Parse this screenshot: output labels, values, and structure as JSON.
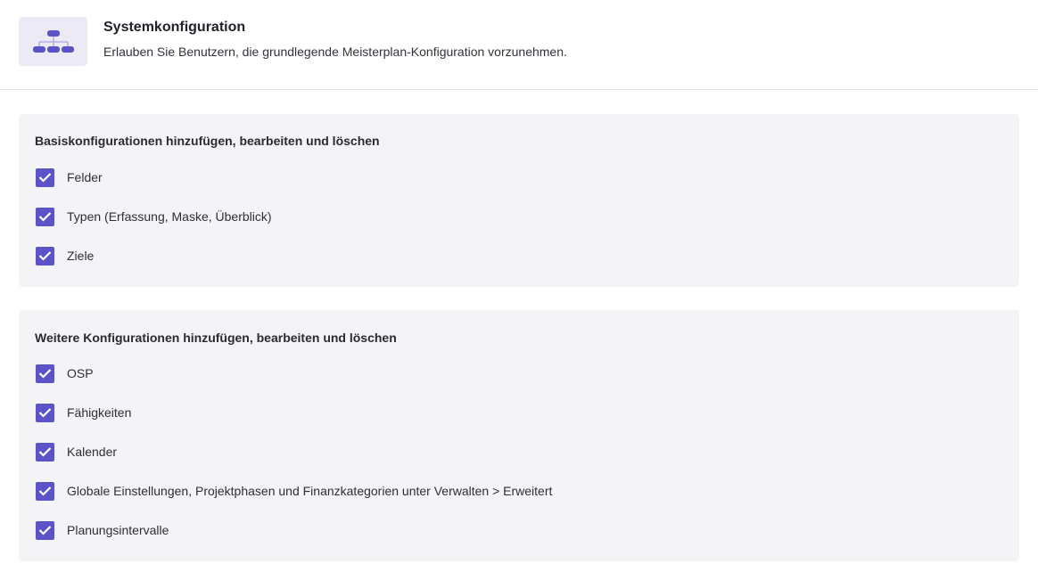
{
  "header": {
    "icon": "hierarchy-icon",
    "title": "Systemkonfiguration",
    "description": "Erlauben Sie Benutzern, die grundlegende Meisterplan-Konfiguration vorzunehmen."
  },
  "colors": {
    "accent": "#5b53c8",
    "section_background": "#f4f4f7",
    "icon_background": "#ecebf5"
  },
  "sections": [
    {
      "title": "Basiskonfigurationen hinzufügen, bearbeiten und löschen",
      "options": [
        {
          "label": "Felder",
          "checked": true
        },
        {
          "label": "Typen (Erfassung, Maske, Überblick)",
          "checked": true
        },
        {
          "label": "Ziele",
          "checked": true
        }
      ]
    },
    {
      "title": "Weitere Konfigurationen hinzufügen, bearbeiten und löschen",
      "options": [
        {
          "label": "OSP",
          "checked": true
        },
        {
          "label": "Fähigkeiten",
          "checked": true
        },
        {
          "label": "Kalender",
          "checked": true
        },
        {
          "label": "Globale Einstellungen, Projektphasen und Finanzkategorien unter Verwalten > Erweitert",
          "checked": true
        },
        {
          "label": "Planungsintervalle",
          "checked": true
        }
      ]
    }
  ]
}
